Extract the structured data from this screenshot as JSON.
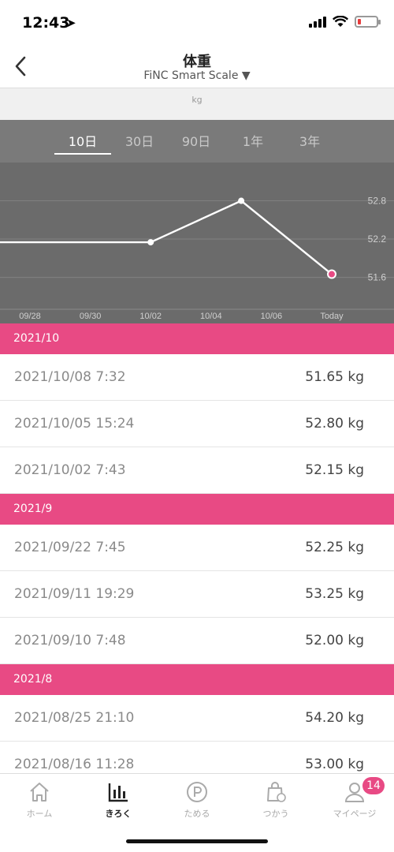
{
  "status": {
    "time": "12:43"
  },
  "header": {
    "title": "体重",
    "subtitle": "FiNC Smart Scale ▼"
  },
  "unit": "kg",
  "range_tabs": [
    "10日",
    "30日",
    "90日",
    "1年",
    "3年"
  ],
  "selected_range": "10日",
  "chart_data": {
    "type": "line",
    "x": [
      "09/28",
      "09/30",
      "10/02",
      "10/04",
      "10/06",
      "Today"
    ],
    "y_ticks": [
      52.8,
      52.2,
      51.6
    ],
    "series": [
      {
        "values": [
          {
            "date": "10/02",
            "y": 52.15
          },
          {
            "date": "10/05",
            "y": 52.8
          },
          {
            "date": "10/08",
            "y": 51.65
          }
        ]
      }
    ],
    "ylim": [
      51.1,
      53.4
    ],
    "grid": true,
    "colors": {
      "line": "#ffffff",
      "highlight": "#e84a84"
    }
  },
  "records": [
    {
      "month": "2021/10",
      "entries": [
        {
          "date": "2021/10/08 7:32",
          "value": "51.65 kg"
        },
        {
          "date": "2021/10/05 15:24",
          "value": "52.80 kg"
        },
        {
          "date": "2021/10/02 7:43",
          "value": "52.15 kg"
        }
      ]
    },
    {
      "month": "2021/9",
      "entries": [
        {
          "date": "2021/09/22 7:45",
          "value": "52.25 kg"
        },
        {
          "date": "2021/09/11 19:29",
          "value": "53.25 kg"
        },
        {
          "date": "2021/09/10 7:48",
          "value": "52.00 kg"
        }
      ]
    },
    {
      "month": "2021/8",
      "entries": [
        {
          "date": "2021/08/25 21:10",
          "value": "54.20 kg"
        },
        {
          "date": "2021/08/16 11:28",
          "value": "53.00 kg"
        }
      ]
    }
  ],
  "bottom_nav": [
    {
      "label": "ホーム",
      "icon": "home-icon"
    },
    {
      "label": "きろく",
      "icon": "bar-chart-icon"
    },
    {
      "label": "ためる",
      "icon": "points-icon"
    },
    {
      "label": "つかう",
      "icon": "shopping-bag-icon"
    },
    {
      "label": "マイページ",
      "icon": "profile-icon",
      "badge": "14"
    }
  ],
  "active_nav": "きろく",
  "colors": {
    "accent": "#e84a84",
    "chart_bg": "#6b6b6b"
  }
}
